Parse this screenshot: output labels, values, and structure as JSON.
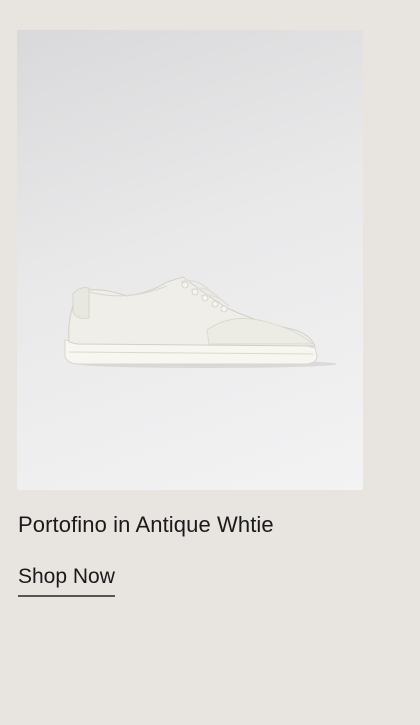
{
  "product": {
    "name": "Portofino in Antique Whtie",
    "image_alt": "White leather sneaker",
    "cta_label": "Shop Now"
  },
  "colors": {
    "page_background": "#e8e5e1",
    "text": "#1a1a1a",
    "shoe": "#f1f0ea"
  }
}
